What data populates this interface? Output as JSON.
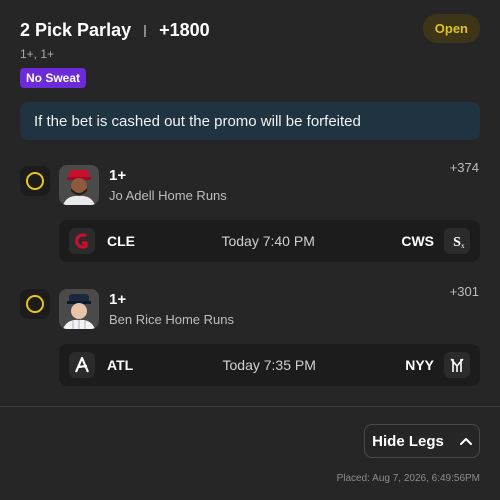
{
  "bet": {
    "title": "2 Pick Parlay",
    "odds": "+1800",
    "subtitle": "1+, 1+",
    "status": "Open",
    "promo_badge": "No Sweat",
    "banner": "If the bet is cashed out the promo will be forfeited"
  },
  "legs": [
    {
      "pick": "1+",
      "market": "Jo Adell Home Runs",
      "odds": "+374",
      "home_team": "CLE",
      "time": "Today 7:40 PM",
      "away_team": "CWS",
      "home_color": "#c8102e",
      "away_color": "#ffffff",
      "avatar_icon": "player-avatar-icon",
      "home_logo_icon": "guardians-logo-icon",
      "away_logo_icon": "white-sox-logo-icon"
    },
    {
      "pick": "1+",
      "market": "Ben Rice Home Runs",
      "odds": "+301",
      "home_team": "ATL",
      "time": "Today 7:35 PM",
      "away_team": "NYY",
      "home_color": "#ffffff",
      "away_color": "#ffffff",
      "avatar_icon": "player-avatar-icon",
      "home_logo_icon": "braves-logo-icon",
      "away_logo_icon": "yankees-logo-icon"
    }
  ],
  "footer": {
    "hide_legs_label": "Hide Legs",
    "placed": "Placed: Aug 7, 2026, 6:49:56PM"
  },
  "colors": {
    "status_text": "#e4bf1e",
    "promo_bg": "#6b2bd8",
    "banner_bg": "#1f3340",
    "radio": "#e9c51c"
  }
}
